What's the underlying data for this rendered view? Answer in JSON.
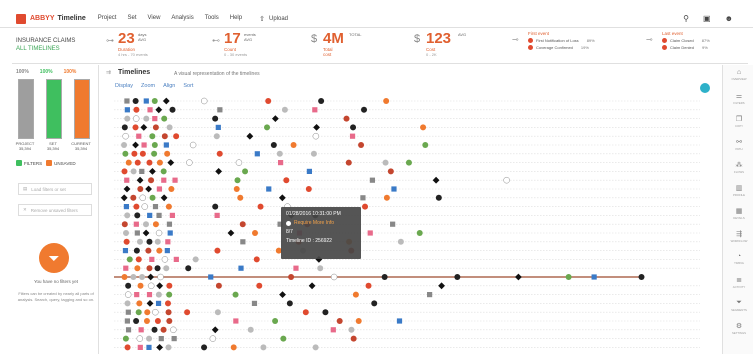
{
  "app": {
    "brand": "ABBYY",
    "product": "Timeline"
  },
  "menu": [
    "Project",
    "Set",
    "View",
    "Analysis",
    "Tools",
    "Help"
  ],
  "upload_label": "Upload",
  "top_icons": [
    "search-icon",
    "inbox-icon",
    "user-icon"
  ],
  "document": {
    "title": "INSURANCE CLAIMS",
    "subtitle": "ALL TIMELINES"
  },
  "metrics": {
    "days": {
      "value": "23",
      "unit_top": "days",
      "unit_bottom": "AVG",
      "label": "Duration",
      "sub": "4 hrs - 70 events"
    },
    "events": {
      "value": "17",
      "unit_top": "events",
      "unit_bottom": "AVG",
      "label": "Count",
      "sub": "0 - 30 events"
    },
    "total": {
      "currency": "$",
      "value": "4M",
      "unit_top": "TOTAL",
      "label": "Total cost"
    },
    "avg_cost": {
      "currency": "$",
      "value": "123",
      "unit_top": "AVG",
      "label": "Cost",
      "sub": "0 - 2K"
    }
  },
  "first_event": {
    "heading": "First event",
    "items": [
      {
        "label": "First Notification of Loss",
        "pct": "89%"
      },
      {
        "label": "Coverage Confirmed",
        "pct": "19%"
      }
    ]
  },
  "last_event": {
    "heading": "Last event",
    "items": [
      {
        "label": "Claim Closed",
        "pct": "87%"
      },
      {
        "label": "Claim Denied",
        "pct": "9%"
      }
    ]
  },
  "sidebar": {
    "bars": [
      {
        "pct": "100%",
        "label": "PROJECT",
        "count": "35,394",
        "fill": 1.0,
        "color": "#9e9e9e",
        "pct_color": "#888888"
      },
      {
        "pct": "100%",
        "label": "SET",
        "count": "35,394",
        "fill": 1.0,
        "color": "#3fbf5f",
        "pct_color": "#3fbf5f"
      },
      {
        "pct": "100%",
        "label": "CURRENT",
        "count": "35,394",
        "fill": 1.0,
        "color": "#f07a2f",
        "pct_color": "#f07a2f"
      }
    ],
    "filters_chip": "FILTERS",
    "unsaved_chip": "UNSAVED",
    "load_filters": "Load filters or set",
    "remove_filters": "Remove unsaved filters",
    "no_filters": "You have no filters yet",
    "no_filters_desc": "Filters can be created by nearly all parts of analysis. Search, query, tagging and so on."
  },
  "timeline": {
    "title": "Timelines",
    "subtitle": "A visual representation of the timelines",
    "tabs": [
      "Display",
      "Zoom",
      "Align",
      "Sort"
    ],
    "row_count": 29,
    "highlight_row": 20,
    "markers_per_row": [
      9,
      9,
      8,
      10,
      9,
      10,
      9,
      11,
      9,
      10,
      9,
      10,
      9,
      8,
      9,
      10,
      9,
      9,
      8,
      9,
      16,
      10,
      9,
      8,
      9,
      10,
      9,
      8,
      9
    ]
  },
  "tooltip": {
    "date": "01/28/2016 10:31:00 PM",
    "event": "Require More Info",
    "count": "8/7",
    "timeline_id": "Timeline ID : 256922"
  },
  "rail": [
    {
      "icon": "home-icon",
      "label": "OVERVIEW"
    },
    {
      "icon": "sliders-icon",
      "label": "FILTERS"
    },
    {
      "icon": "copy-icon",
      "label": "COPY"
    },
    {
      "icon": "tree-icon",
      "label": "PATH"
    },
    {
      "icon": "graph-icon",
      "label": "FLOWS"
    },
    {
      "icon": "chart-icon",
      "label": "PROFILE"
    },
    {
      "icon": "table-icon",
      "label": "DETAILS"
    },
    {
      "icon": "flow-icon",
      "label": "WORKFLOW"
    },
    {
      "icon": "clock-icon",
      "label": "TIMING"
    },
    {
      "icon": "list-icon",
      "label": "ACTIVITY"
    },
    {
      "icon": "filter-icon",
      "label": "SEGMENTS"
    },
    {
      "icon": "settings-icon",
      "label": "SETTINGS"
    }
  ],
  "colors": {
    "accent": "#e04a2f",
    "orange": "#f07a2f",
    "green": "#3fbf5f",
    "link": "#4a7fc0",
    "highlight_line": "#9e4a2f"
  }
}
